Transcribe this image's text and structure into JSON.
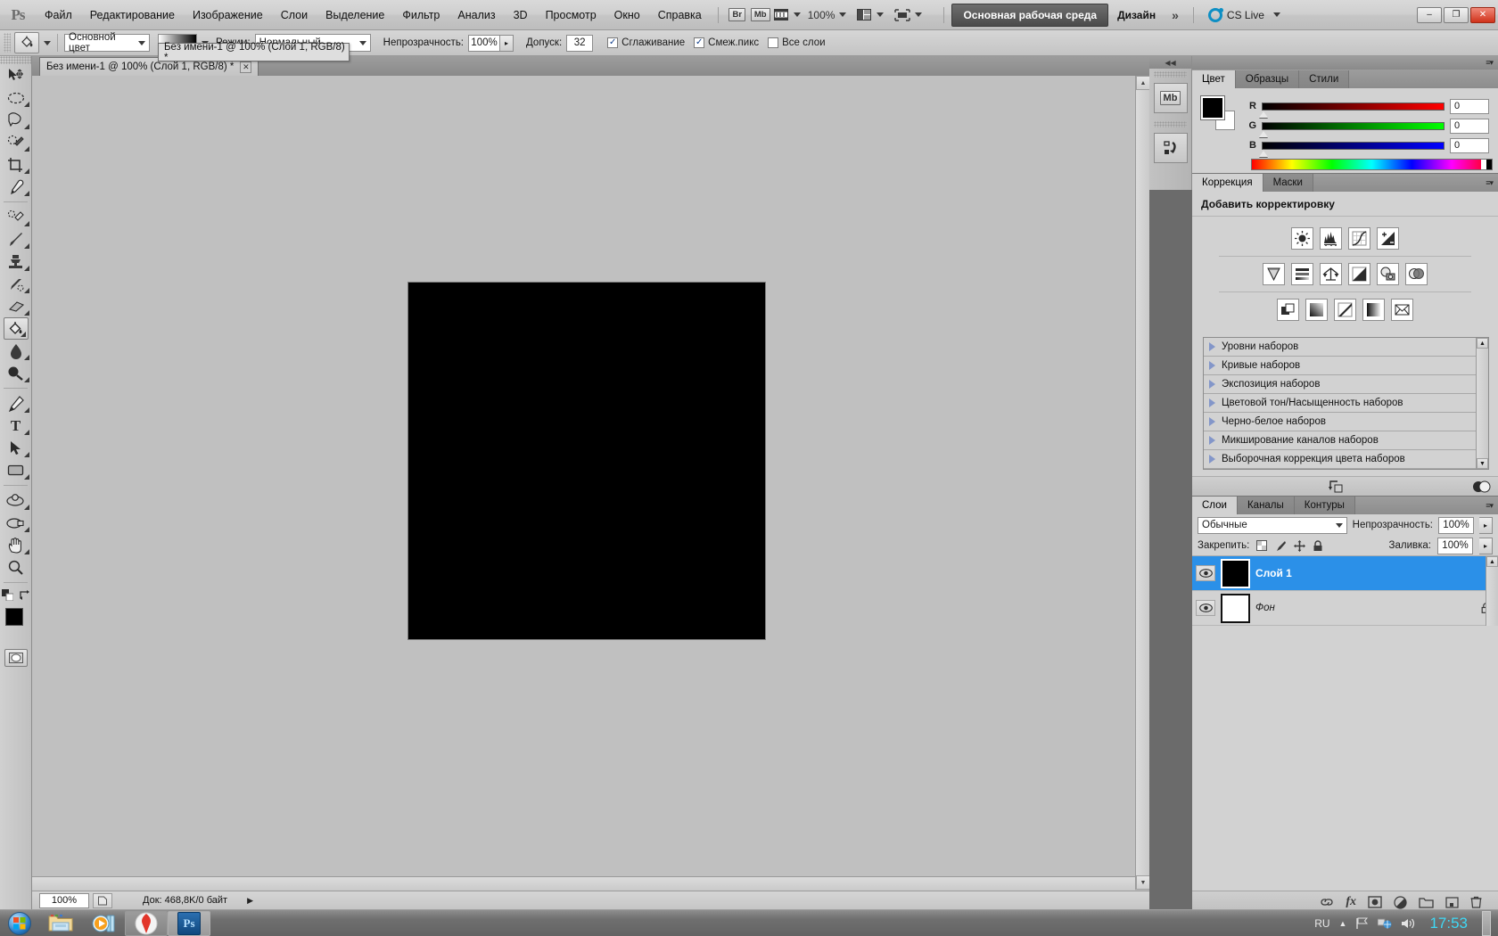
{
  "app": {
    "name": "Adobe Photoshop",
    "logo": "Ps"
  },
  "menubar": {
    "items": [
      {
        "label": "Файл"
      },
      {
        "label": "Редактирование"
      },
      {
        "label": "Изображение"
      },
      {
        "label": "Слои"
      },
      {
        "label": "Выделение"
      },
      {
        "label": "Фильтр"
      },
      {
        "label": "Анализ"
      },
      {
        "label": "3D"
      },
      {
        "label": "Просмотр"
      },
      {
        "label": "Окно"
      },
      {
        "label": "Справка"
      }
    ],
    "bridge_label": "Br",
    "minibridge_label": "Mb",
    "zoom_value": "100%",
    "workspace_active": "Основная рабочая среда",
    "workspace_design": "Дизайн",
    "workspace_more": "»",
    "cslive_label": "CS Live",
    "window_buttons": {
      "minimize": "–",
      "maximize": "❐",
      "close": "✕"
    }
  },
  "optionsbar": {
    "tool_icon": "paint-bucket-icon",
    "fill_source_label": "Основной цвет",
    "mode_label": "Режим:",
    "mode_value": "Нормальный",
    "opacity_label": "Непрозрачность:",
    "opacity_value": "100%",
    "tolerance_label": "Допуск:",
    "tolerance_value": "32",
    "antialias_label": "Сглаживание",
    "antialias_checked": true,
    "contiguous_label": "Смеж.пикс",
    "contiguous_checked": true,
    "alllayers_label": "Все слои",
    "alllayers_checked": false
  },
  "tooltip": {
    "text": "Без имени-1 @ 100% (Слой 1, RGB/8) *"
  },
  "toolbox": {
    "tools": [
      {
        "name": "move-tool",
        "glyph": "move"
      },
      {
        "name": "elliptical-marquee-tool",
        "glyph": "ellipse"
      },
      {
        "name": "lasso-tool",
        "glyph": "lasso"
      },
      {
        "name": "quick-selection-tool",
        "glyph": "quickselect"
      },
      {
        "name": "crop-tool",
        "glyph": "crop"
      },
      {
        "name": "eyedropper-tool",
        "glyph": "eyedropper"
      },
      {
        "name": "spot-healing-brush-tool",
        "glyph": "heal"
      },
      {
        "name": "brush-tool",
        "glyph": "brush"
      },
      {
        "name": "clone-stamp-tool",
        "glyph": "stamp"
      },
      {
        "name": "history-brush-tool",
        "glyph": "historybrush"
      },
      {
        "name": "eraser-tool",
        "glyph": "eraser"
      },
      {
        "name": "paint-bucket-tool",
        "glyph": "bucket",
        "selected": true
      },
      {
        "name": "blur-tool",
        "glyph": "blur"
      },
      {
        "name": "dodge-tool",
        "glyph": "dodge"
      },
      {
        "name": "pen-tool",
        "glyph": "pen"
      },
      {
        "name": "horizontal-type-tool",
        "glyph": "type"
      },
      {
        "name": "path-selection-tool",
        "glyph": "pathselect"
      },
      {
        "name": "rectangle-tool",
        "glyph": "rectangle"
      },
      {
        "name": "3d-object-rotate-tool",
        "glyph": "rotate3d"
      },
      {
        "name": "3d-camera-rotate-tool",
        "glyph": "camera3d"
      },
      {
        "name": "hand-tool",
        "glyph": "hand"
      },
      {
        "name": "zoom-tool",
        "glyph": "zoom"
      }
    ],
    "foreground_color": "#000000",
    "background_color": "#ffffff",
    "quickmask_name": "quick-mask-button"
  },
  "document": {
    "tab_title": "Без имени-1 @ 100% (Слой 1, RGB/8) *",
    "close_glyph": "✕",
    "canvas_fill": "#000000"
  },
  "statusbar": {
    "zoom": "100%",
    "doc_info": "Док: 468,8K/0 байт"
  },
  "panels": {
    "color": {
      "tabs": [
        {
          "label": "Цвет",
          "active": true
        },
        {
          "label": "Образцы",
          "active": false
        },
        {
          "label": "Стили",
          "active": false
        }
      ],
      "foreground": "#000000",
      "background": "#ffffff",
      "channels": [
        {
          "label": "R",
          "value": "0"
        },
        {
          "label": "G",
          "value": "0"
        },
        {
          "label": "B",
          "value": "0"
        }
      ]
    },
    "adjustments": {
      "tabs": [
        {
          "label": "Коррекция",
          "active": true
        },
        {
          "label": "Маски",
          "active": false
        }
      ],
      "title": "Добавить корректировку",
      "icons_row1": [
        {
          "name": "brightness-contrast-icon"
        },
        {
          "name": "levels-icon"
        },
        {
          "name": "curves-icon"
        },
        {
          "name": "exposure-icon"
        }
      ],
      "icons_row2": [
        {
          "name": "vibrance-icon"
        },
        {
          "name": "hue-saturation-icon"
        },
        {
          "name": "color-balance-icon"
        },
        {
          "name": "black-white-icon"
        },
        {
          "name": "photo-filter-icon"
        },
        {
          "name": "channel-mixer-icon"
        }
      ],
      "icons_row3": [
        {
          "name": "invert-icon"
        },
        {
          "name": "posterize-icon"
        },
        {
          "name": "threshold-icon"
        },
        {
          "name": "gradient-map-icon"
        },
        {
          "name": "selective-color-icon"
        }
      ],
      "presets": [
        {
          "label": "Уровни наборов"
        },
        {
          "label": "Кривые наборов"
        },
        {
          "label": "Экспозиция наборов"
        },
        {
          "label": "Цветовой тон/Насыщенность наборов"
        },
        {
          "label": "Черно-белое наборов"
        },
        {
          "label": "Микширование каналов наборов"
        },
        {
          "label": "Выборочная коррекция цвета наборов"
        }
      ]
    },
    "layers": {
      "tabs": [
        {
          "label": "Слои",
          "active": true
        },
        {
          "label": "Каналы",
          "active": false
        },
        {
          "label": "Контуры",
          "active": false
        }
      ],
      "blend_mode": "Обычные",
      "opacity_label": "Непрозрачность:",
      "opacity_value": "100%",
      "lock_label": "Закрепить:",
      "lock_icons": [
        {
          "name": "lock-transparent-pixels-icon"
        },
        {
          "name": "lock-image-pixels-icon"
        },
        {
          "name": "lock-position-icon"
        },
        {
          "name": "lock-all-icon"
        }
      ],
      "fill_label": "Заливка:",
      "fill_value": "100%",
      "items": [
        {
          "name": "Слой 1",
          "selected": true,
          "thumb": "#000000",
          "locked": false
        },
        {
          "name": "Фон",
          "selected": false,
          "thumb": "#ffffff",
          "locked": true
        }
      ],
      "footer_buttons": [
        {
          "name": "link-layers-button",
          "glyph": "⚭"
        },
        {
          "name": "layer-style-button",
          "glyph": "fx"
        },
        {
          "name": "layer-mask-button",
          "glyph": "□"
        },
        {
          "name": "new-fill-adjustment-button",
          "glyph": "◑"
        },
        {
          "name": "new-group-button",
          "glyph": "☐"
        },
        {
          "name": "new-layer-button",
          "glyph": "⬚"
        },
        {
          "name": "delete-layer-button",
          "glyph": "Ὕ1"
        }
      ]
    }
  },
  "taskbar": {
    "start_name": "start-button",
    "items": [
      {
        "name": "explorer-taskbar-icon"
      },
      {
        "name": "media-player-taskbar-icon"
      },
      {
        "name": "yandex-browser-taskbar-icon",
        "boxed": true
      },
      {
        "name": "photoshop-taskbar-icon",
        "active": true,
        "label": "Ps"
      }
    ],
    "tray": {
      "language": "RU",
      "time": "17:53"
    }
  }
}
